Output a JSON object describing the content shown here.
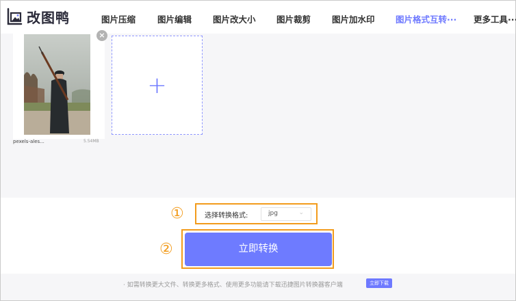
{
  "brand": {
    "name": "改图鸭",
    "logo_icon": "photo-frame-icon",
    "accent_color": "#6e79ff"
  },
  "nav": {
    "items": [
      {
        "label": "图片压缩"
      },
      {
        "label": "图片编辑"
      },
      {
        "label": "图片改大小"
      },
      {
        "label": "图片裁剪"
      },
      {
        "label": "图片加水印"
      },
      {
        "label": "图片格式互转···",
        "active": true
      },
      {
        "label": "更多工具···"
      }
    ]
  },
  "upload": {
    "files": [
      {
        "name": "pexels-ales...",
        "size": "5.54MB",
        "thumbnail": "photo-soldier-with-rifle"
      }
    ],
    "add_icon": "+",
    "remove_icon": "×"
  },
  "markers": {
    "step1": "①",
    "step2": "②",
    "highlight_color": "#f29b1b"
  },
  "format": {
    "label": "选择转换格式:",
    "selected": "jpg",
    "chevron": "⌄"
  },
  "convert": {
    "label": "立即转换",
    "button_color": "#6e7bff"
  },
  "notice": {
    "text": "· 如需转换更大文件、转换更多格式、使用更多功能请下载迅捷图片转换器客户端",
    "link_label": "立即下载"
  }
}
